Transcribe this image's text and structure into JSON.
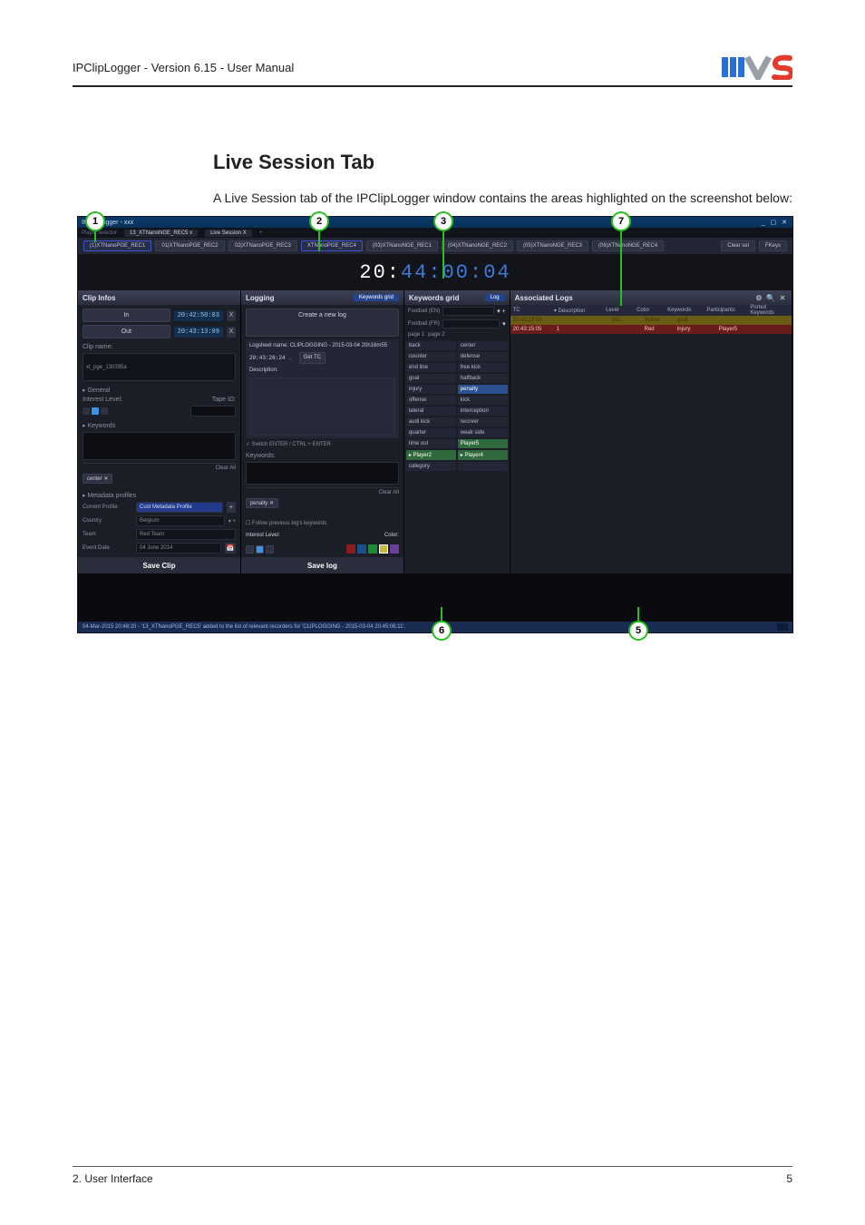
{
  "header": {
    "title": "IPClipLogger - Version 6.15 - User Manual"
  },
  "section": {
    "heading": "Live Session Tab",
    "desc": "A Live Session tab of the IPClipLogger window contains the areas highlighted on the screenshot below:"
  },
  "footer": {
    "left": "2. User Interface",
    "right": "5"
  },
  "callouts": {
    "c1": "1",
    "c2": "2",
    "c3": "3",
    "c7": "7",
    "c6": "6",
    "c5": "5"
  },
  "app": {
    "titlebar": "IPClipLogger - xxx",
    "window_buttons": "_ ▢ ✕",
    "player_tab_prefix": "PlayerSelector",
    "player_tab1": "13_XTNanoNGE_REC5  x",
    "player_tab2": "Live Session  X",
    "recorders": [
      "(1)XTNanoPGE_REC1",
      "01|XTNanoPGE_REC2",
      "02|XTNanoPGE_REC3",
      "XTNanoPGE_REC4",
      "(03)XTNanoNGE_REC1",
      "(04)XTNanoNGE_REC2",
      "(05)XTNanoNGE_REC3",
      "(06)XTNanoNGE_REC4"
    ],
    "clear_sel": "Clear sel",
    "fkeys": "FKeys",
    "timecode_a": "20:",
    "timecode_b": "44:00:04",
    "clip_infos": {
      "title": "Clip Infos",
      "in_label": "In",
      "in_tc": "20:42:50:03",
      "out_label": "Out",
      "out_tc": "20:43:13:09",
      "clip_name_lbl": "Clip name:",
      "clip_name": "xt_pge_130395a",
      "general_lbl": "▸ General",
      "interest_lbl": "Interest Level:",
      "tape_lbl": "Tape ID:",
      "keywords_lbl": "▸ Keywords",
      "clear_all": "Clear All",
      "kw_chip": "center ✕",
      "profiles_lbl": "▸ Metadata profiles",
      "current_profile_lbl": "Current Profile",
      "current_profile": "Cust Metadata Profile",
      "country_lbl": "Country",
      "country": "Belgium",
      "team_lbl": "Team",
      "team": "Red Team",
      "eventdate_lbl": "Event Date",
      "eventdate": "04 June 2014",
      "save": "Save Clip"
    },
    "logging": {
      "title": "Logging",
      "pill": "Keywords grid",
      "create": "Create a new log",
      "logsheet_lbl": "Logsheet name:",
      "logsheet": "CLIPLOGGING - 2015-03-04 20h16m55",
      "tc": "20:43:26:24 .",
      "get_tc": "Get TC",
      "desc_lbl": "Description:",
      "switch": "✓ Switch ENTER / CTRL + ENTER",
      "kw_lbl": "Keywords:",
      "clear_all": "Clear All",
      "kw_chip": "penalty ✕",
      "follow": "☐ Follow previous log's keywords",
      "interest_lbl": "Interest Level:",
      "color_lbl": "Color:",
      "save": "Save log"
    },
    "kwgrid": {
      "title": "Keywords grid",
      "pill": "Log",
      "tab1_lbl": "Football (EN)",
      "tab2_lbl": "Football (FR)",
      "page1": "page 1",
      "page2": "page 2",
      "cells": [
        "back",
        "center",
        "counter",
        "defense",
        "end line",
        "free kick",
        "goal",
        "halfback",
        "injury",
        "penalty",
        "offense",
        "kick",
        "lateral",
        "interception",
        "audi kick",
        "recover",
        "quarter",
        "weak side",
        "time out",
        "Player5",
        "▸ Player2",
        "▸ Player4",
        "category",
        ""
      ]
    },
    "assoc": {
      "title": "Associated Logs",
      "cols": [
        "TC",
        "▾ Description",
        "Level",
        "Color",
        "Keywords",
        "Participants",
        "Ported Keywords"
      ],
      "row1": {
        "tc": "20:43:22:02",
        "desc": "",
        "level": "OO",
        "color": "Yellow",
        "kw": "goal",
        "part": "",
        "pk": ""
      },
      "row2": {
        "tc": "20:43:15:05",
        "desc": "1",
        "level": "",
        "color": "Red",
        "kw": "Injury",
        "part": "Player5",
        "pk": ""
      }
    },
    "status": "04-Mar-2015 20:48:20 - '13_XTNanoPGE_REC5' added to the list of relevant recorders for 'CLIPLOGGING - 2015-03-04 20:45:06:11'."
  }
}
